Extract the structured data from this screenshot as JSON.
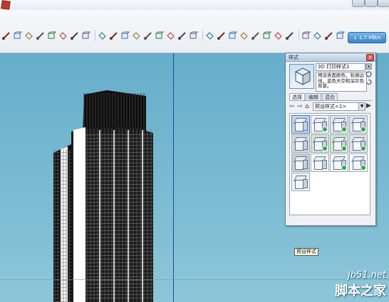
{
  "toolbar": {
    "network_speed": "↓ 1.7 MB/s",
    "tools": [
      "select-tool",
      "eraser-tool",
      "paint-tool",
      "line-tool",
      "arc-tool",
      "rectangle-tool",
      "push-pull-tool",
      "move-tool",
      "rotate-tool",
      "offset-tool",
      "follow-me-tool",
      "scale-tool",
      "tape-tool",
      "dimension-tool",
      "protractor-tool",
      "text-tool",
      "axes-tool",
      "section-tool",
      "orbit-tool",
      "pan-tool",
      "zoom-tool",
      "zoom-window-tool",
      "zoom-extents-tool",
      "walk-tool",
      "look-around-tool",
      "position-camera-tool",
      "3d-warehouse-tool",
      "extension-warehouse-tool",
      "layout-tool"
    ]
  },
  "styles_panel": {
    "title": "样式",
    "close_icon": "✕",
    "style_name": "3D 打印样式1",
    "style_description": "预设表面颜色，轮廓边线，蓝色天空和深灰色背景。",
    "tabs": [
      "选择",
      "编辑",
      "混合"
    ],
    "active_tab": 0,
    "collection": "预设样式<1>",
    "nav_back": "⇦",
    "nav_forward": "⇨",
    "nav_home": "⌂",
    "nav_detail": "▶",
    "dropdown_arrow": "▼",
    "grid_columns": 4,
    "styles": [
      {
        "kind": "selected",
        "check": false
      },
      {
        "kind": "default",
        "check": true
      },
      {
        "kind": "shaded",
        "check": true
      },
      {
        "kind": "shaded",
        "check": true
      },
      {
        "kind": "hidden",
        "check": false
      },
      {
        "kind": "green",
        "check": true
      },
      {
        "kind": "green",
        "check": true
      },
      {
        "kind": "shaded",
        "check": true
      },
      {
        "kind": "gray",
        "check": false
      },
      {
        "kind": "wire",
        "check": false
      },
      {
        "kind": "wire",
        "check": true
      },
      {
        "kind": "wire",
        "check": true
      },
      {
        "kind": "default",
        "check": false
      }
    ],
    "hover_tooltip": "预设样式"
  },
  "watermark": {
    "site": "jb51.net",
    "name": "脚本之家"
  },
  "colors": {
    "sky": "#6fb3cc",
    "axis_blue": "#2b3fa8",
    "panel_bg": "#eef0f3",
    "check_green": "#2fa84a"
  }
}
